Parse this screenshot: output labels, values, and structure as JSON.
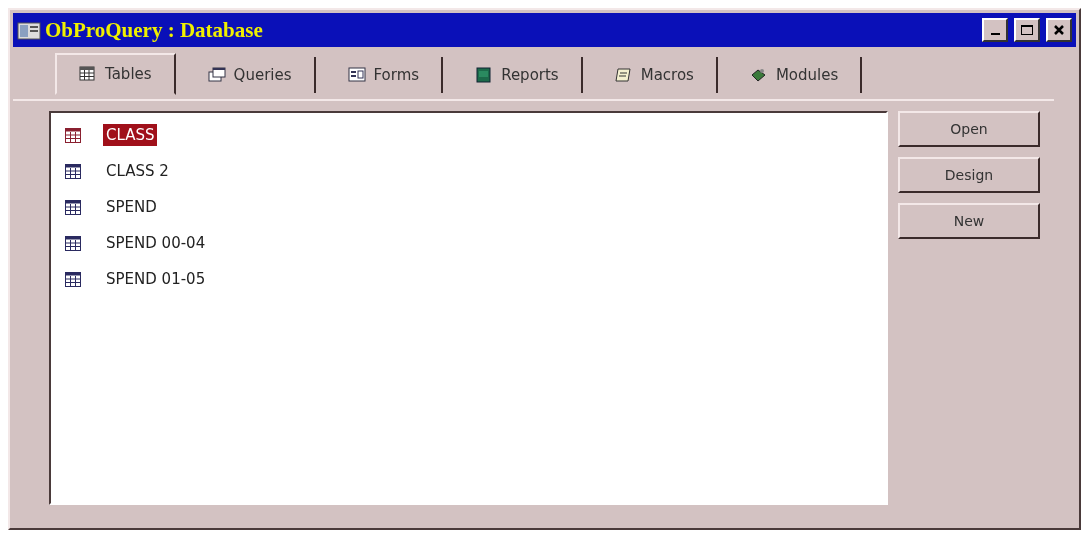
{
  "window": {
    "title": "ObProQuery : Database"
  },
  "tabs": [
    {
      "label": "Tables",
      "kind": "table",
      "selected": true
    },
    {
      "label": "Queries",
      "kind": "query",
      "selected": false
    },
    {
      "label": "Forms",
      "kind": "form",
      "selected": false
    },
    {
      "label": "Reports",
      "kind": "report",
      "selected": false
    },
    {
      "label": "Macros",
      "kind": "macro",
      "selected": false
    },
    {
      "label": "Modules",
      "kind": "module",
      "selected": false
    }
  ],
  "items": [
    {
      "name": "CLASS",
      "selected": true
    },
    {
      "name": "CLASS 2",
      "selected": false
    },
    {
      "name": "SPEND",
      "selected": false
    },
    {
      "name": "SPEND 00-04",
      "selected": false
    },
    {
      "name": "SPEND 01-05",
      "selected": false
    }
  ],
  "buttons": [
    "Open",
    "Design",
    "New"
  ]
}
